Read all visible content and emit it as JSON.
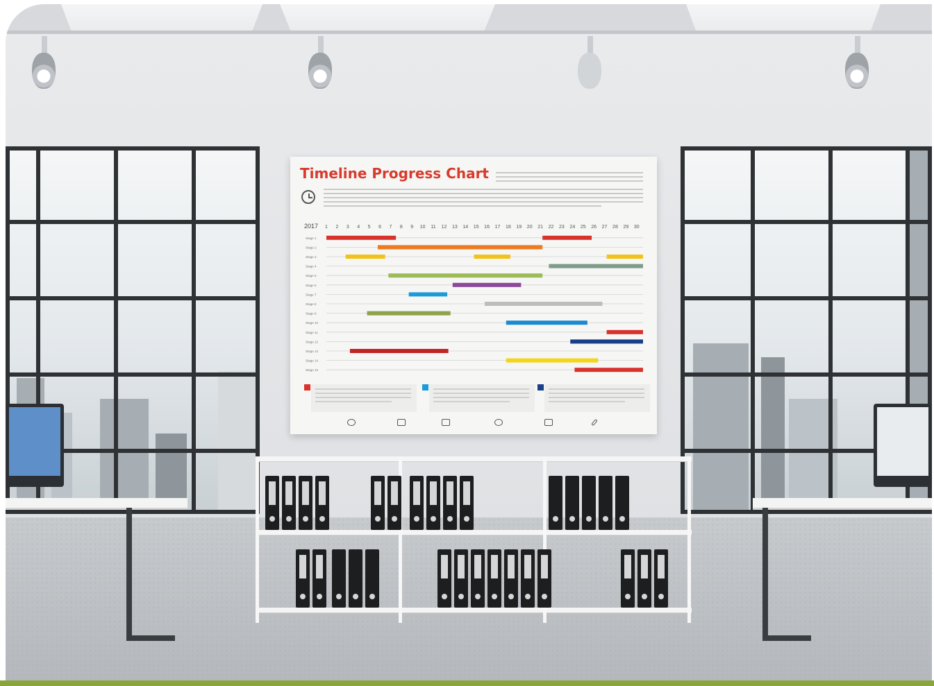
{
  "poster": {
    "title": "Timeline Progress Chart",
    "year": "2017"
  },
  "chart_data": {
    "type": "gantt",
    "title": "Timeline Progress Chart",
    "x_label": "2017",
    "x": [
      1,
      2,
      3,
      4,
      5,
      6,
      7,
      8,
      9,
      10,
      11,
      12,
      13,
      14,
      15,
      16,
      17,
      18,
      19,
      20,
      21,
      22,
      23,
      24,
      25,
      26,
      27,
      28,
      29,
      30
    ],
    "rows": [
      "Stage 1",
      "Stage 2",
      "Stage 3",
      "Stage 4",
      "Stage 5",
      "Stage 6",
      "Stage 7",
      "Stage 8",
      "Stage 9",
      "Stage 10",
      "Stage 11",
      "Stage 12",
      "Stage 13",
      "Stage 14",
      "Stage 15"
    ],
    "tasks": [
      {
        "row": 0,
        "start": 1,
        "end": 7.5,
        "color": "#d8322c"
      },
      {
        "row": 0,
        "start": 21.2,
        "end": 25.8,
        "color": "#d8322c"
      },
      {
        "row": 1,
        "start": 5.8,
        "end": 21.2,
        "color": "#ee7a22"
      },
      {
        "row": 2,
        "start": 2.8,
        "end": 6.5,
        "color": "#f3c21a"
      },
      {
        "row": 2,
        "start": 14.8,
        "end": 18.2,
        "color": "#f3c21a"
      },
      {
        "row": 2,
        "start": 27.2,
        "end": 30.6,
        "color": "#f3c21a"
      },
      {
        "row": 3,
        "start": 21.8,
        "end": 30.6,
        "color": "#7f9c8a"
      },
      {
        "row": 4,
        "start": 6.8,
        "end": 21.2,
        "color": "#9dbb57"
      },
      {
        "row": 5,
        "start": 12.8,
        "end": 19.2,
        "color": "#8a4a9a"
      },
      {
        "row": 6,
        "start": 8.7,
        "end": 12.3,
        "color": "#1c9bd8"
      },
      {
        "row": 7,
        "start": 15.8,
        "end": 26.8,
        "color": "#bdbdbd"
      },
      {
        "row": 8,
        "start": 4.8,
        "end": 12.6,
        "color": "#8fa247"
      },
      {
        "row": 9,
        "start": 17.8,
        "end": 25.4,
        "color": "#1c8ad0"
      },
      {
        "row": 10,
        "start": 27.2,
        "end": 30.6,
        "color": "#d8322c"
      },
      {
        "row": 11,
        "start": 23.8,
        "end": 30.6,
        "color": "#1a3f8a"
      },
      {
        "row": 12,
        "start": 3.2,
        "end": 12.4,
        "color": "#c02424"
      },
      {
        "row": 13,
        "start": 17.8,
        "end": 26.4,
        "color": "#f3d51a"
      },
      {
        "row": 14,
        "start": 24.2,
        "end": 30.6,
        "color": "#d8322c"
      }
    ]
  },
  "notes": [
    {
      "color": "#d8322c"
    },
    {
      "color": "#1c9bd8"
    },
    {
      "color": "#1a3f8a"
    }
  ],
  "colors": {
    "frame_accent": "#8aa53a",
    "title_red": "#d83a2b"
  }
}
